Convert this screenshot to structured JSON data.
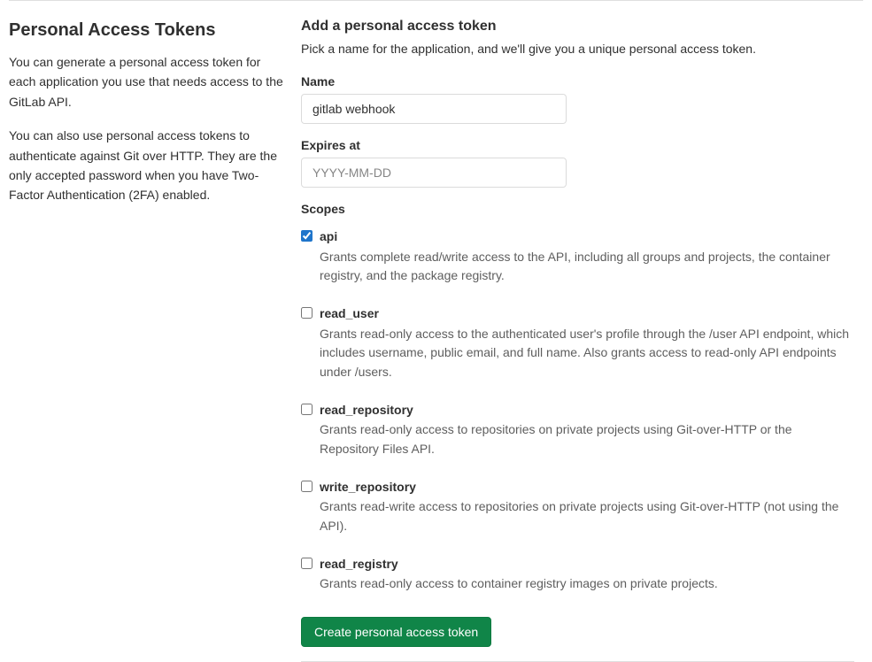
{
  "sidebar": {
    "title": "Personal Access Tokens",
    "para1": "You can generate a personal access token for each application you use that needs access to the GitLab API.",
    "para2": "You can also use personal access tokens to authenticate against Git over HTTP. They are the only accepted password when you have Two-Factor Authentication (2FA) enabled."
  },
  "form": {
    "heading": "Add a personal access token",
    "subtext": "Pick a name for the application, and we'll give you a unique personal access token.",
    "name_label": "Name",
    "name_value": "gitlab webhook",
    "expires_label": "Expires at",
    "expires_placeholder": "YYYY-MM-DD",
    "expires_value": "",
    "scopes_label": "Scopes",
    "scopes": [
      {
        "id": "api",
        "name": "api",
        "checked": true,
        "desc": "Grants complete read/write access to the API, including all groups and projects, the container registry, and the package registry."
      },
      {
        "id": "read_user",
        "name": "read_user",
        "checked": false,
        "desc": "Grants read-only access to the authenticated user's profile through the /user API endpoint, which includes username, public email, and full name. Also grants access to read-only API endpoints under /users."
      },
      {
        "id": "read_repository",
        "name": "read_repository",
        "checked": false,
        "desc": "Grants read-only access to repositories on private projects using Git-over-HTTP or the Repository Files API."
      },
      {
        "id": "write_repository",
        "name": "write_repository",
        "checked": false,
        "desc": "Grants read-write access to repositories on private projects using Git-over-HTTP (not using the API)."
      },
      {
        "id": "read_registry",
        "name": "read_registry",
        "checked": false,
        "desc": "Grants read-only access to container registry images on private projects."
      }
    ],
    "submit_label": "Create personal access token"
  }
}
